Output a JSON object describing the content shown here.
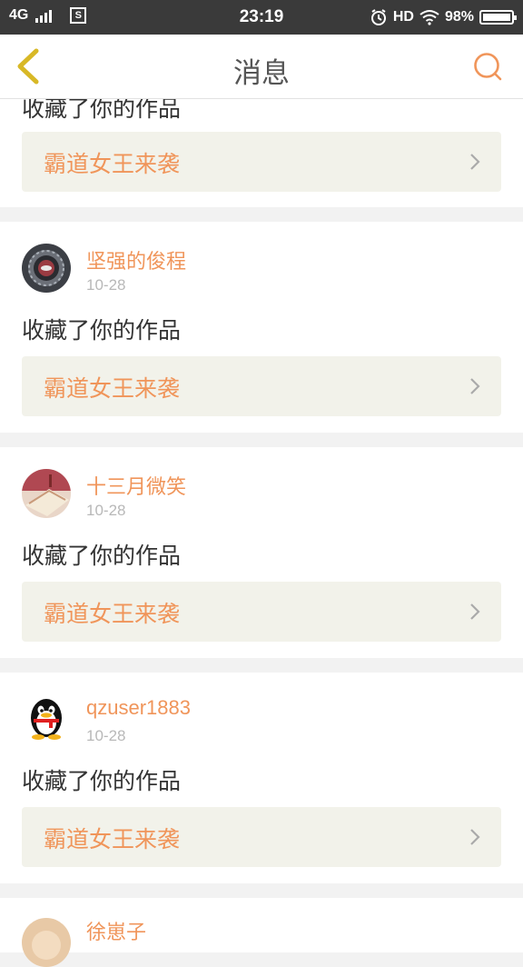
{
  "status_bar": {
    "network": "4G",
    "sim_icon": "S",
    "time": "23:19",
    "hd": "HD",
    "battery": "98%"
  },
  "header": {
    "title": "消息",
    "back_icon": "chevron-left-icon",
    "search_icon": "search-icon"
  },
  "colors": {
    "accent": "#f0955a",
    "back_arrow": "#d8b826",
    "work_bg": "#f2f2ea",
    "divider_bg": "#f2f2f2"
  },
  "messages": [
    {
      "user": "",
      "date": "",
      "action": "收藏了你的作品",
      "work_title": "霸道女王来袭"
    },
    {
      "user": "坚强的俊程",
      "date": "10-28",
      "action": "收藏了你的作品",
      "work_title": "霸道女王来袭"
    },
    {
      "user": "十三月微笑",
      "date": "10-28",
      "action": "收藏了你的作品",
      "work_title": "霸道女王来袭"
    },
    {
      "user": "qzuser1883",
      "date": "10-28",
      "action": "收藏了你的作品",
      "work_title": "霸道女王来袭"
    },
    {
      "user": "徐崽子",
      "date": "",
      "action": "",
      "work_title": ""
    }
  ]
}
